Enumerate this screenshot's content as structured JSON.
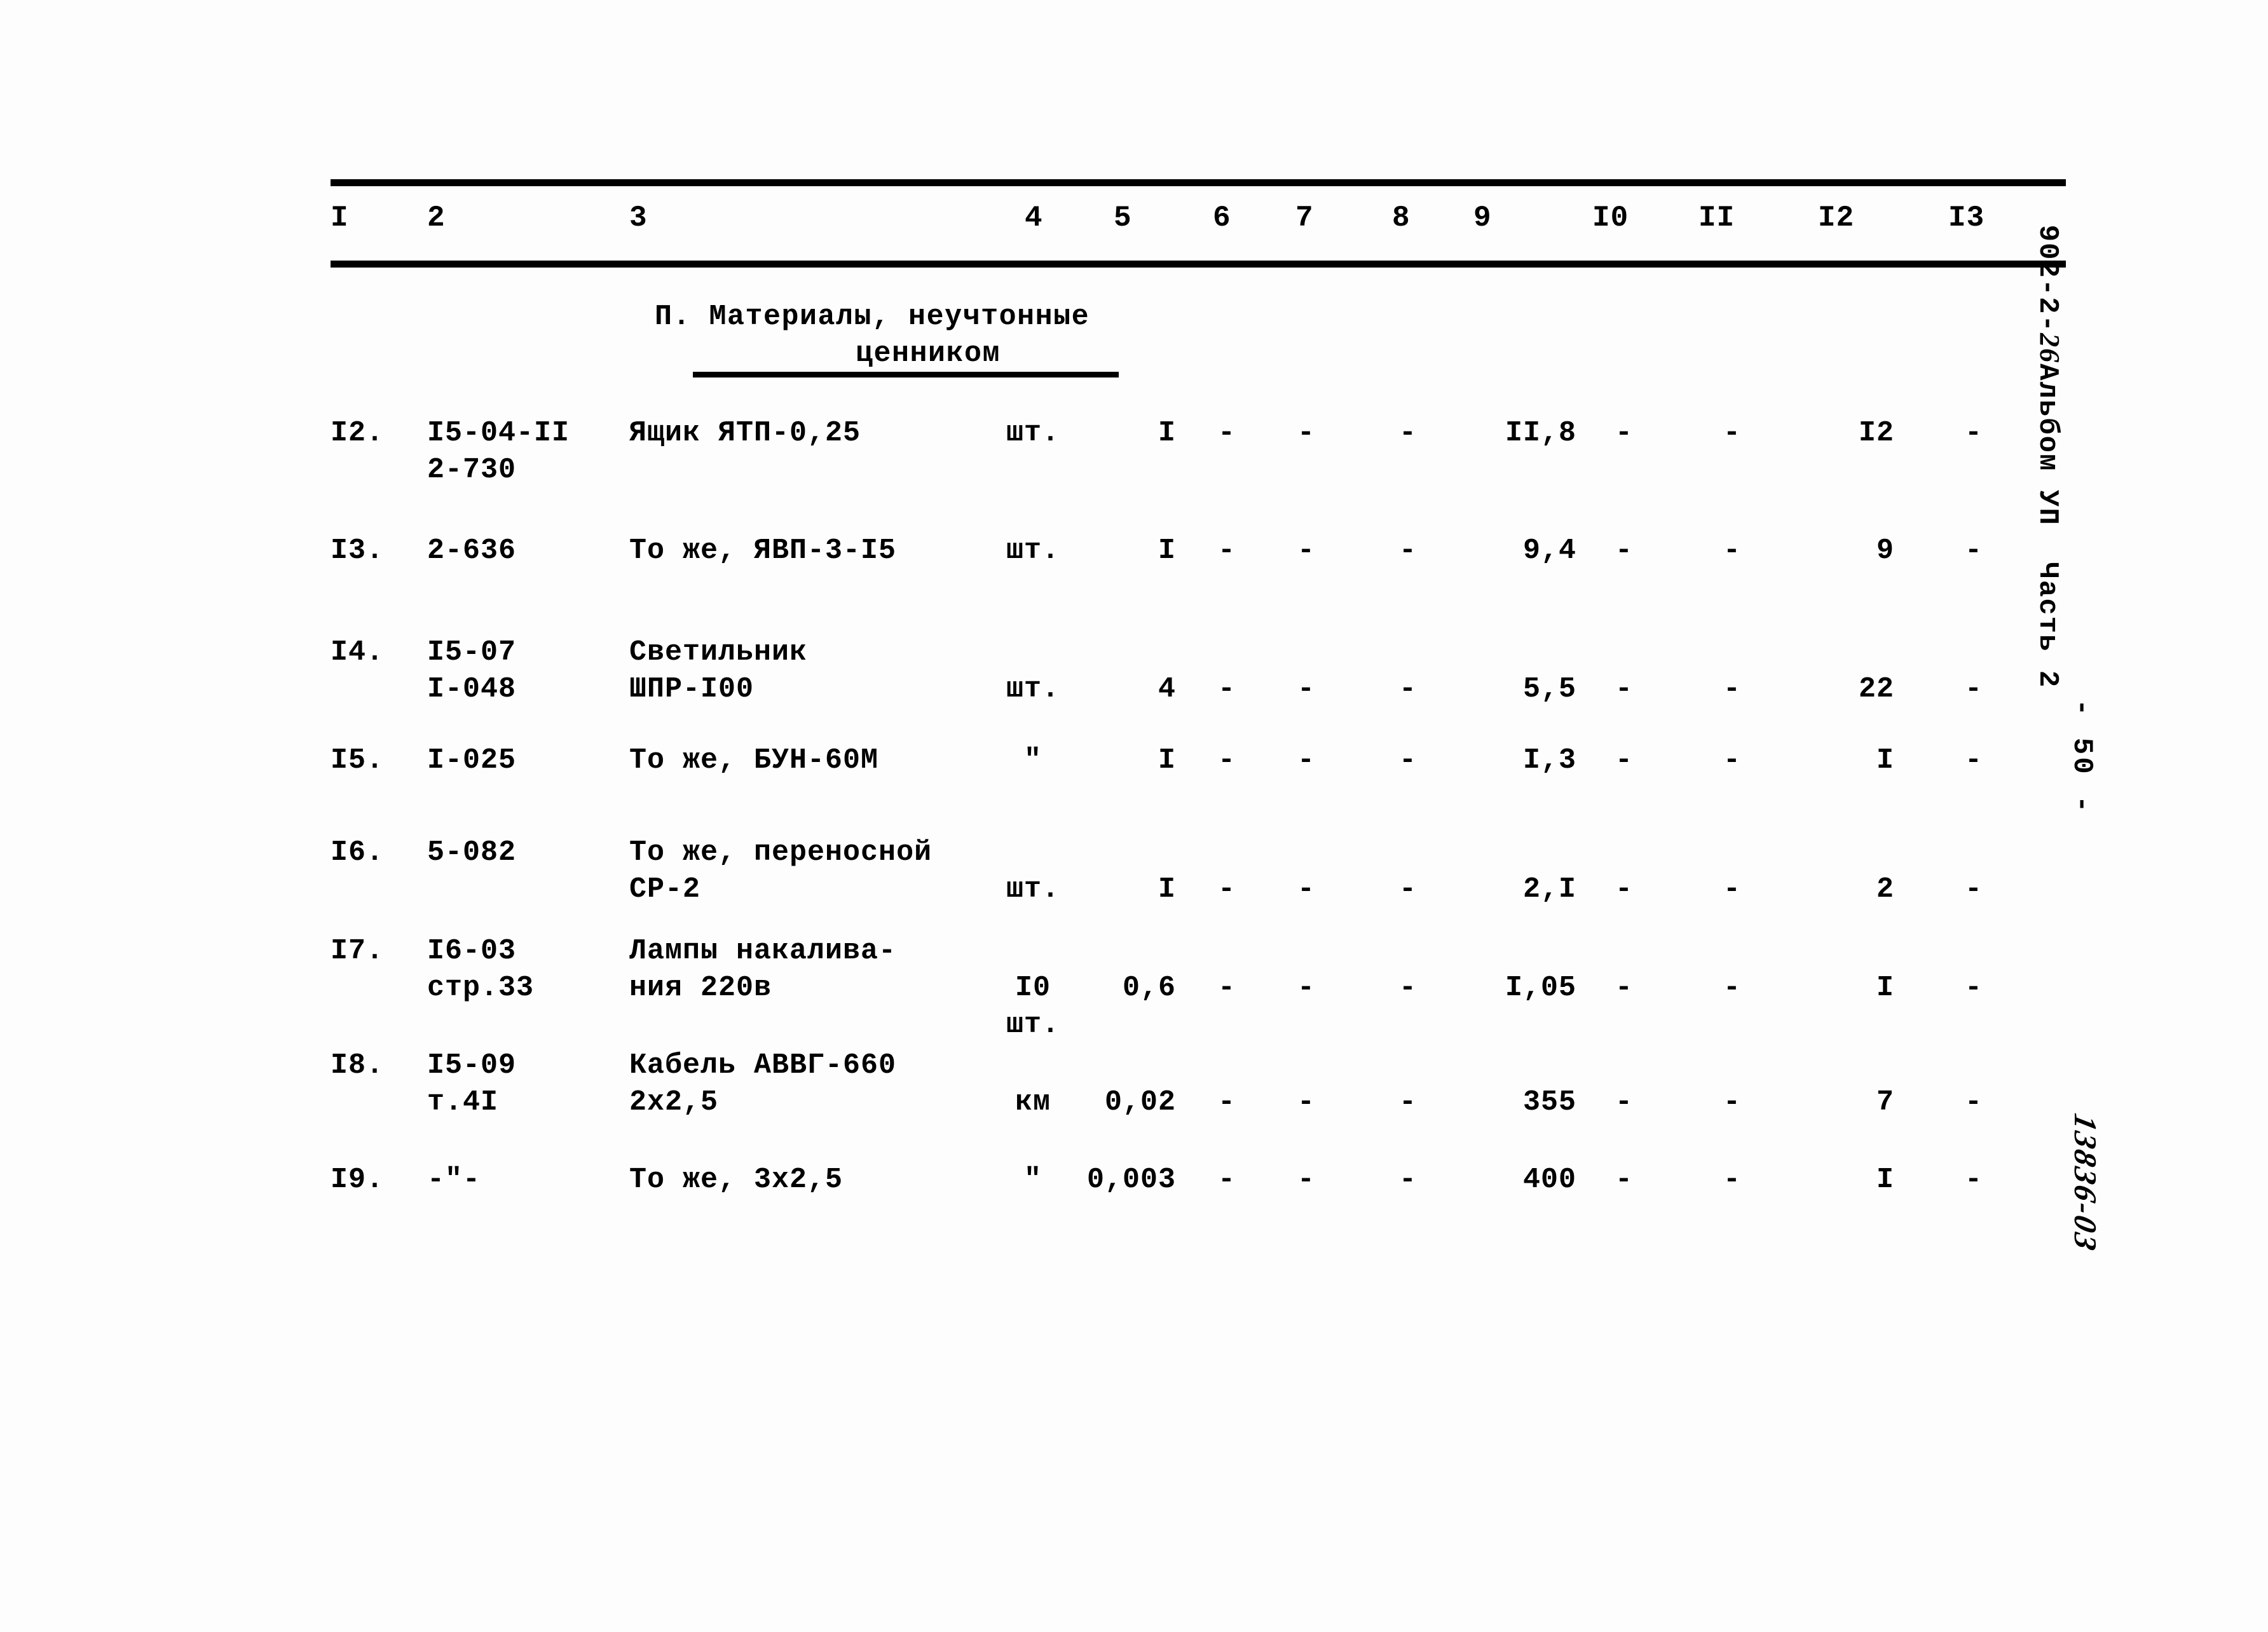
{
  "document": {
    "doc_code_prefix": "902-2-",
    "doc_code_hand": "26",
    "doc_code_suffix": "Альбом УП  Часть 2",
    "page_number": "- 50 -",
    "archive_code": "13836-03"
  },
  "table": {
    "column_headers": [
      "I",
      "2",
      "3",
      "4",
      "5",
      "6",
      "7",
      "8",
      "9",
      "I0",
      "II",
      "I2",
      "I3"
    ],
    "section_title_line1": "П. Материалы, неучтонные",
    "section_title_line2": "ценником",
    "rows": [
      {
        "num": "I2.",
        "code": "I5-04-II",
        "code2": "2-730",
        "name": "Ящик ЯТП-0,25",
        "name2": "",
        "unit": "шт.",
        "unit2": "",
        "qty": "I",
        "c6": "-",
        "c7": "-",
        "c8": "-",
        "c9": "II,8",
        "c10": "-",
        "c11": "-",
        "c12": "I2",
        "c13": "-"
      },
      {
        "num": "I3.",
        "code": "2-636",
        "code2": "",
        "name": "То же, ЯВП-3-I5",
        "name2": "",
        "unit": "шт.",
        "unit2": "",
        "qty": "I",
        "c6": "-",
        "c7": "-",
        "c8": "-",
        "c9": "9,4",
        "c10": "-",
        "c11": "-",
        "c12": "9",
        "c13": "-"
      },
      {
        "num": "I4.",
        "code": "I5-07",
        "code2": "I-048",
        "name": "Светильник",
        "name2": "ШПР-I00",
        "unit": "шт.",
        "unit2": "",
        "qty": "4",
        "c6": "-",
        "c7": "-",
        "c8": "-",
        "c9": "5,5",
        "c10": "-",
        "c11": "-",
        "c12": "22",
        "c13": "-"
      },
      {
        "num": "I5.",
        "code": "I-025",
        "code2": "",
        "name": "То же, БУН-60М",
        "name2": "",
        "unit": "\"",
        "unit2": "",
        "qty": "I",
        "c6": "-",
        "c7": "-",
        "c8": "-",
        "c9": "I,3",
        "c10": "-",
        "c11": "-",
        "c12": "I",
        "c13": "-"
      },
      {
        "num": "I6.",
        "code": "5-082",
        "code2": "",
        "name": "То же, переносной",
        "name2": "СР-2",
        "unit": "шт.",
        "unit2": "",
        "qty": "I",
        "c6": "-",
        "c7": "-",
        "c8": "-",
        "c9": "2,I",
        "c10": "-",
        "c11": "-",
        "c12": "2",
        "c13": "-"
      },
      {
        "num": "I7.",
        "code": "I6-03",
        "code2": "стр.33",
        "name": "Лампы накалива-",
        "name2": "ния 220в",
        "unit": "I0",
        "unit2": "шт.",
        "qty": "0,6",
        "c6": "-",
        "c7": "-",
        "c8": "-",
        "c9": "I,05",
        "c10": "-",
        "c11": "-",
        "c12": "I",
        "c13": "-"
      },
      {
        "num": "I8.",
        "code": "I5-09",
        "code2": "т.4I",
        "name": "Кабель АВВГ-660",
        "name2": "2х2,5",
        "unit": "км",
        "unit2": "",
        "qty": "0,02",
        "c6": "-",
        "c7": "-",
        "c8": "-",
        "c9": "355",
        "c10": "-",
        "c11": "-",
        "c12": "7",
        "c13": "-"
      },
      {
        "num": "I9.",
        "code": "-\"-",
        "code2": "",
        "name": "То же, 3х2,5",
        "name2": "",
        "unit": "\"",
        "unit2": "",
        "qty": "0,003",
        "c6": "-",
        "c7": "-",
        "c8": "-",
        "c9": "400",
        "c10": "-",
        "c11": "-",
        "c12": "I",
        "c13": "-"
      }
    ]
  }
}
